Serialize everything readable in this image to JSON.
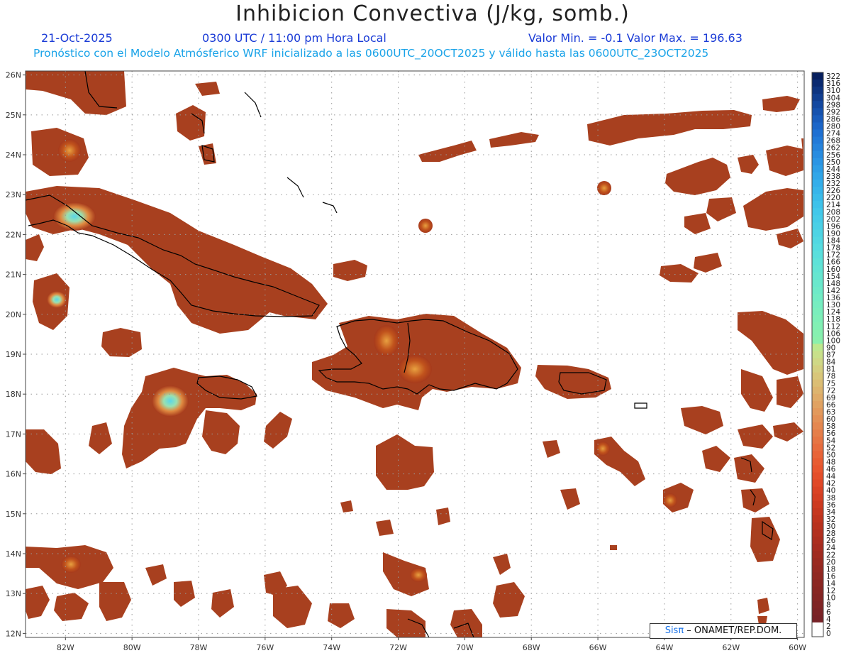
{
  "title": "Inhibicion Convectiva (J/kg, somb.)",
  "header": {
    "date": "21-Oct-2025",
    "time": "0300 UTC / 11:00 pm Hora Local",
    "valores": "Valor Min. = -0.1  Valor Max. = 196.63",
    "info": "Pronóstico con el Modelo Atmósferico WRF inicializado a las 0600UTC_20OCT2025 y válido hasta las  0600UTC_23OCT2025"
  },
  "map": {
    "lon_range": [
      -83.2,
      -59.8
    ],
    "lat_range": [
      11.9,
      26.1
    ],
    "lon_ticks": [
      "82W",
      "80W",
      "78W",
      "76W",
      "74W",
      "72W",
      "70W",
      "68W",
      "66W",
      "64W",
      "62W",
      "60W"
    ],
    "lat_ticks": [
      "12N",
      "13N",
      "14N",
      "15N",
      "16N",
      "17N",
      "18N",
      "19N",
      "20N",
      "21N",
      "22N",
      "23N",
      "24N",
      "25N",
      "26N"
    ],
    "grid": true
  },
  "colorbar": {
    "labels": [
      "322",
      "316",
      "310",
      "304",
      "298",
      "292",
      "286",
      "280",
      "274",
      "268",
      "262",
      "256",
      "250",
      "244",
      "238",
      "232",
      "226",
      "220",
      "214",
      "208",
      "202",
      "196",
      "190",
      "184",
      "178",
      "172",
      "166",
      "160",
      "154",
      "148",
      "142",
      "136",
      "130",
      "124",
      "118",
      "112",
      "106",
      "100",
      "90",
      "87",
      "84",
      "81",
      "78",
      "75",
      "72",
      "69",
      "66",
      "63",
      "60",
      "58",
      "56",
      "54",
      "52",
      "50",
      "48",
      "46",
      "44",
      "42",
      "40",
      "38",
      "36",
      "34",
      "32",
      "30",
      "28",
      "26",
      "24",
      "22",
      "20",
      "18",
      "16",
      "14",
      "12",
      "10",
      "8",
      "6",
      "4",
      "2",
      "0"
    ],
    "colors": [
      "#08205e",
      "#0a2a70",
      "#0d3480",
      "#103e90",
      "#1348a0",
      "#1652ae",
      "#195cbc",
      "#1c66c8",
      "#1f70d2",
      "#227ad8",
      "#2583dc",
      "#288ce0",
      "#2b95e4",
      "#2e9ee6",
      "#31a6e8",
      "#34aeea",
      "#37b5ea",
      "#3abcea",
      "#3ec2ea",
      "#42c8ea",
      "#46cce8",
      "#4ad0e6",
      "#4ed4e4",
      "#52d8e2",
      "#56dce0",
      "#5adfdc",
      "#5ee2d8",
      "#62e4d4",
      "#66e6d0",
      "#6ae8cc",
      "#6eeac8",
      "#72ecc4",
      "#76edc0",
      "#7aeebc",
      "#7eefb8",
      "#82f0b4",
      "#86f0b0",
      "#8af0ac",
      "#bde88e",
      "#c8e08a",
      "#cfd886",
      "#d4cf80",
      "#d8c67a",
      "#dbbd74",
      "#ddb46e",
      "#dfab68",
      "#e0a262",
      "#e2995c",
      "#e39056",
      "#e48750",
      "#e57e4a",
      "#e67544",
      "#e76c3e",
      "#e86438",
      "#e85c32",
      "#e8552e",
      "#e44e2a",
      "#e04827",
      "#da4224",
      "#d43e22",
      "#cd3a20",
      "#c6371f",
      "#bf341e",
      "#b8321e",
      "#b2301f",
      "#ac2e1f",
      "#a62c20",
      "#a02b20",
      "#9a2a21",
      "#952922",
      "#902822",
      "#8b2723",
      "#872623",
      "#832524",
      "#7f2425",
      "#7b2326",
      "#772227",
      "#ffffff"
    ]
  },
  "credit": {
    "brand": "Sisπ",
    "text": " – ONAMET/REP.DOM."
  }
}
